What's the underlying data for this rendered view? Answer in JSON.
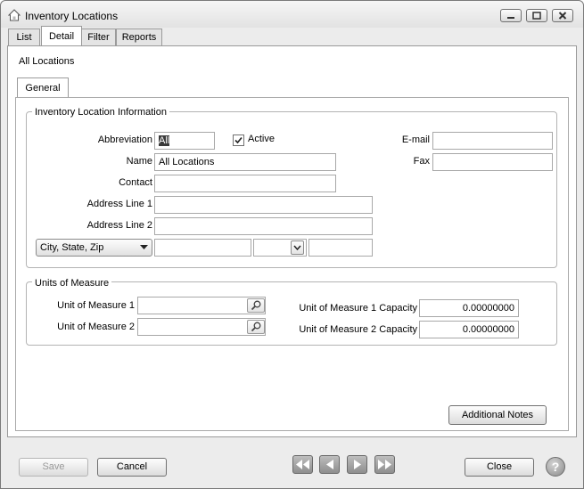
{
  "window": {
    "title": "Inventory Locations"
  },
  "tabs": [
    {
      "label": "List"
    },
    {
      "label": "Detail"
    },
    {
      "label": "Filter"
    },
    {
      "label": "Reports"
    }
  ],
  "record_heading": "All Locations",
  "subtabs": [
    {
      "label": "General"
    }
  ],
  "location_info": {
    "group_title": "Inventory Location Information",
    "abbreviation_label": "Abbreviation",
    "abbreviation_value": "All",
    "active_label": "Active",
    "active_checked": true,
    "email_label": "E-mail",
    "email_value": "",
    "name_label": "Name",
    "name_value": "All Locations",
    "fax_label": "Fax",
    "fax_value": "",
    "contact_label": "Contact",
    "contact_value": "",
    "address1_label": "Address Line 1",
    "address1_value": "",
    "address2_label": "Address Line 2",
    "address2_value": "",
    "city_state_zip_label": "City, State, Zip",
    "city_value": "",
    "state_value": "",
    "zip_value": ""
  },
  "units": {
    "group_title": "Units of Measure",
    "uom1_label": "Unit of Measure 1",
    "uom1_value": "",
    "uom2_label": "Unit of Measure 2",
    "uom2_value": "",
    "cap1_label": "Unit of Measure 1 Capacity",
    "cap1_value": "0.00000000",
    "cap2_label": "Unit of Measure 2 Capacity",
    "cap2_value": "0.00000000"
  },
  "additional_notes_label": "Additional Notes",
  "footer": {
    "save_label": "Save",
    "cancel_label": "Cancel",
    "close_label": "Close",
    "help_glyph": "?"
  },
  "colors": {
    "accent": "#2f5fb5",
    "nav_button": "#a6a6a6"
  }
}
